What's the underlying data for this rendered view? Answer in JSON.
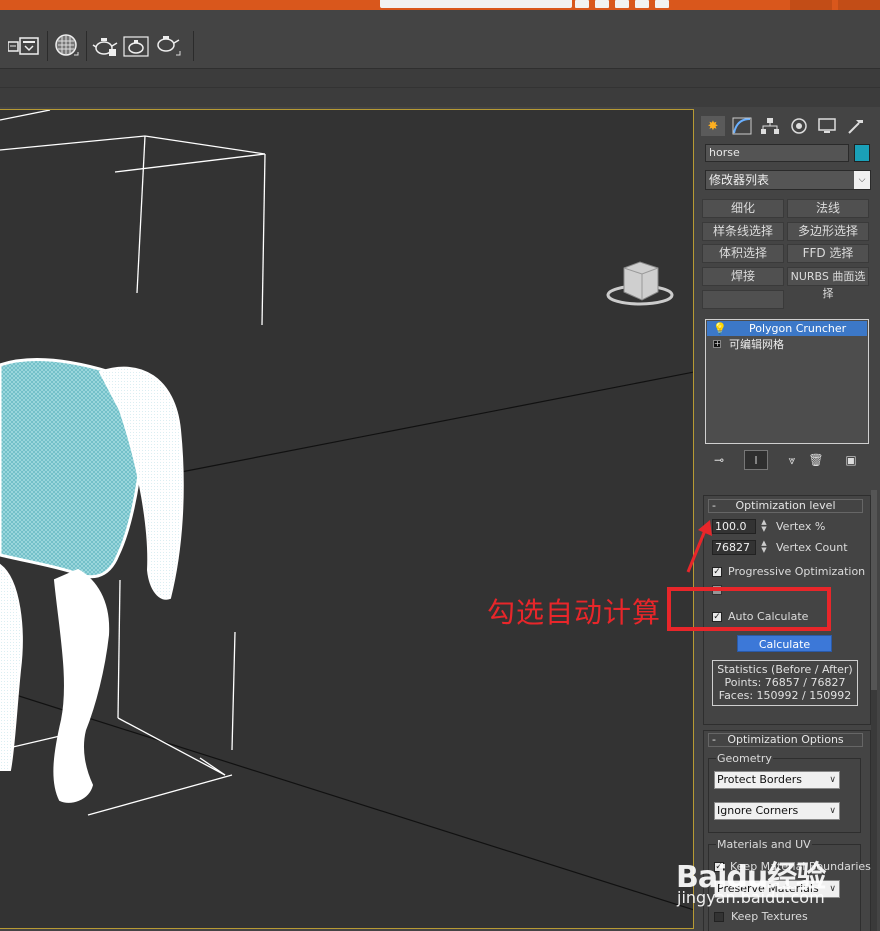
{
  "toolbar": {
    "icons": [
      "render-frame-icon",
      "render-setup-icon",
      "material-editor-icon",
      "render-teapot-icon",
      "render-active-icon",
      "render-production-icon"
    ]
  },
  "viewport": {
    "object": "horse"
  },
  "command_panel": {
    "tabs": [
      "create-icon",
      "modify-icon",
      "hierarchy-icon",
      "motion-icon",
      "display-icon",
      "utilities-icon"
    ],
    "object_name": "horse",
    "object_color": "#1aa0b8",
    "modifier_list_label": "修改器列表",
    "modifier_buttons": [
      "细化",
      "法线",
      "样条线选择",
      "多边形选择",
      "体积选择",
      "FFD 选择",
      "焊接",
      "NURBS 曲面选择",
      ""
    ],
    "stack_items": [
      "Polygon Cruncher",
      "可编辑网格"
    ]
  },
  "optimization_level": {
    "title": "Optimization level",
    "vertex_percent_value": "100.0",
    "vertex_percent_label": "Vertex %",
    "vertex_count_value": "76827",
    "vertex_count_label": "Vertex Count",
    "progressive_label": "Progressive Optimization",
    "auto_calculate_label": "Auto Calculate",
    "calculate_label": "Calculate",
    "stats_title": "Statistics (Before / After)",
    "stats_points": "Points: 76857 / 76827",
    "stats_faces": "Faces: 150992 / 150992"
  },
  "optimization_options": {
    "title": "Optimization Options",
    "geometry_label": "Geometry",
    "protect_borders": "Protect Borders",
    "ignore_corners": "Ignore Corners",
    "materials_label": "Materials and UV",
    "keep_boundaries_label": "Keep Material Boundaries",
    "preserve_materials": "Preserve Materials",
    "keep_textures_label": "Keep Textures"
  },
  "annotation": {
    "text": "勾选自动计算",
    "color": "#e8262a"
  },
  "watermark": {
    "brand": "Baidu经验",
    "url": "jingyan.baidu.com"
  }
}
